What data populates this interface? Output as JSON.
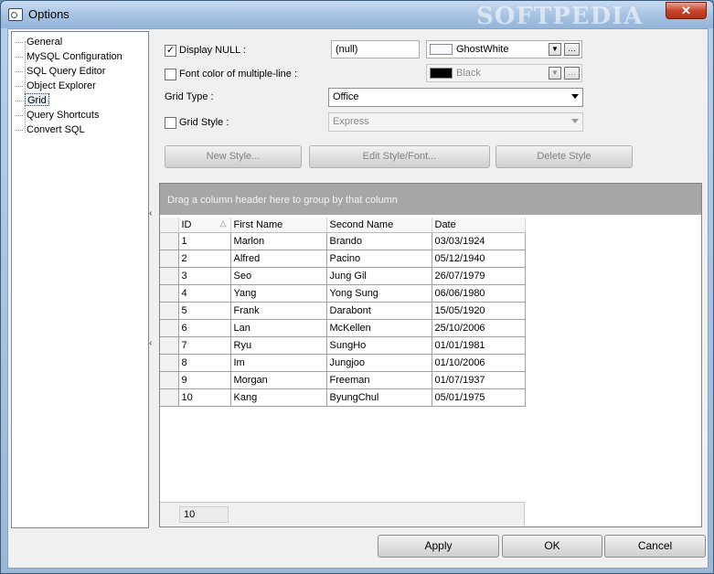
{
  "window": {
    "title": "Options",
    "close_symbol": "✕",
    "watermark": "SOFTPEDIA"
  },
  "tree": {
    "items": [
      {
        "label": "General",
        "selected": false
      },
      {
        "label": "MySQL Configuration",
        "selected": false
      },
      {
        "label": "SQL Query Editor",
        "selected": false
      },
      {
        "label": "Object Explorer",
        "selected": false
      },
      {
        "label": "Grid",
        "selected": true
      },
      {
        "label": "Query Shortcuts",
        "selected": false
      },
      {
        "label": "Convert SQL",
        "selected": false
      }
    ]
  },
  "settings": {
    "display_null": {
      "label": "Display NULL :",
      "checked": true,
      "value": "(null)",
      "color_name": "GhostWhite",
      "color": "#f8f8ff"
    },
    "font_color_multiline": {
      "label": "Font color of multiple-line :",
      "checked": false,
      "color_name": "Black",
      "color": "#000000"
    },
    "grid_type": {
      "label": "Grid Type :",
      "value": "Office"
    },
    "grid_style": {
      "label": "Grid Style :",
      "checked": false,
      "value": "Express"
    },
    "buttons": {
      "new_style": "New Style...",
      "edit_style": "Edit Style/Font...",
      "delete_style": "Delete Style"
    }
  },
  "grid": {
    "group_panel_text": "Drag a column header here to group by that column",
    "columns": [
      "ID",
      "First Name",
      "Second Name",
      "Date"
    ],
    "sort_glyph": "△",
    "rows": [
      [
        "1",
        "Marlon",
        "Brando",
        "03/03/1924"
      ],
      [
        "2",
        "Alfred",
        "Pacino",
        "05/12/1940"
      ],
      [
        "3",
        "Seo",
        "Jung Gil",
        "26/07/1979"
      ],
      [
        "4",
        "Yang",
        "Yong Sung",
        "06/06/1980"
      ],
      [
        "5",
        "Frank",
        "Darabont",
        "15/05/1920"
      ],
      [
        "6",
        "Lan",
        "McKellen",
        "25/10/2006"
      ],
      [
        "7",
        "Ryu",
        "SungHo",
        "01/01/1981"
      ],
      [
        "8",
        "Im",
        "Jungjoo",
        "01/10/2006"
      ],
      [
        "9",
        "Morgan",
        "Freeman",
        "01/07/1937"
      ],
      [
        "10",
        "Kang",
        "ByungChul",
        "05/01/1975"
      ]
    ],
    "footer_count": "10"
  },
  "dialog_buttons": {
    "apply": "Apply",
    "ok": "OK",
    "cancel": "Cancel"
  },
  "colors": {
    "accent": "#9ab7d6",
    "group_panel": "#a6a6a6"
  }
}
